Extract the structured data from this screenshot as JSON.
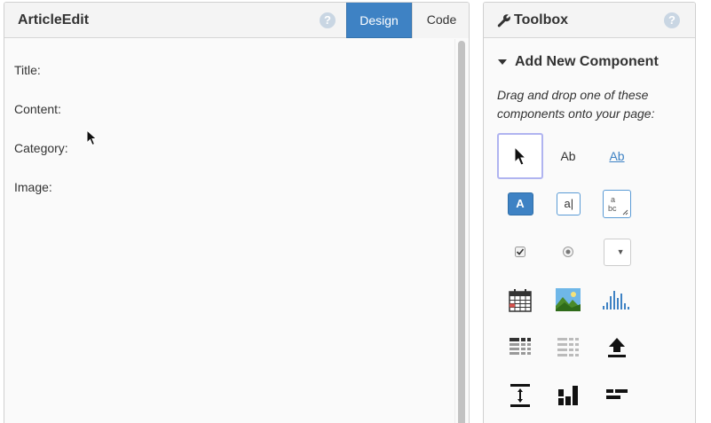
{
  "editor": {
    "title": "ArticleEdit",
    "help_icon": "?",
    "tabs": [
      {
        "label": "Design",
        "active": true
      },
      {
        "label": "Code",
        "active": false
      }
    ],
    "fields": [
      "Title:",
      "Content:",
      "Category:",
      "Image:"
    ]
  },
  "toolbox": {
    "title": "Toolbox",
    "help_icon": "?",
    "section_title": "Add New Component",
    "hint": "Drag and drop one of these components onto your page:",
    "tools": [
      {
        "name": "pointer-tool",
        "icon": "pointer-icon",
        "selected": true
      },
      {
        "name": "label-tool",
        "icon": "label-icon",
        "text": "Ab"
      },
      {
        "name": "link-tool",
        "icon": "link-icon",
        "text": "Ab"
      },
      {
        "name": "button-tool",
        "icon": "button-icon",
        "text": "A"
      },
      {
        "name": "textbox-tool",
        "icon": "textbox-icon",
        "text": "a|"
      },
      {
        "name": "textarea-tool",
        "icon": "textarea-icon",
        "text_line1": "a",
        "text_line2": "bc"
      },
      {
        "name": "checkbox-tool",
        "icon": "checkbox-icon"
      },
      {
        "name": "radio-tool",
        "icon": "radio-icon"
      },
      {
        "name": "dropdown-tool",
        "icon": "dropdown-icon",
        "text": "▼"
      },
      {
        "name": "date-picker-tool",
        "icon": "calendar-icon"
      },
      {
        "name": "image-tool",
        "icon": "image-icon"
      },
      {
        "name": "chart-tool",
        "icon": "bar-chart-icon"
      },
      {
        "name": "data-grid-tool",
        "icon": "data-grid-icon"
      },
      {
        "name": "repeating-panel-tool",
        "icon": "repeating-panel-icon"
      },
      {
        "name": "file-upload-tool",
        "icon": "upload-icon"
      },
      {
        "name": "spacer-tool",
        "icon": "spacer-icon"
      },
      {
        "name": "column-panel-tool",
        "icon": "column-panel-icon"
      },
      {
        "name": "flow-panel-tool",
        "icon": "flow-panel-icon"
      }
    ]
  },
  "colors": {
    "accent": "#3e82c4",
    "selected_border": "#b0b4f0",
    "help_icon": "#c9d6e3"
  }
}
